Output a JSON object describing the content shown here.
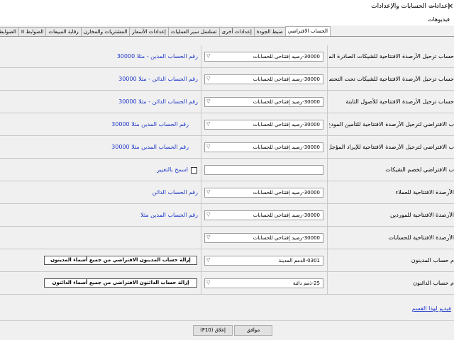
{
  "window": {
    "title": "إعدادات الحسابات والإعدادات",
    "minimize": "—",
    "close": "✕"
  },
  "menu": {
    "videos": "فيديوهات"
  },
  "tabs": [
    "الحساب الافتراضي",
    "ضبط الجودة",
    "إعدادات أخرى",
    "تسلسل سير العمليات",
    "إعدادات الأسعار",
    "المشتريات والمخازن",
    "رقابة المبيعات",
    "الضوابط II",
    "الضوابط I",
    "إع"
  ],
  "rows": [
    {
      "label": "حساب ترحيل الأرصدة الافتتاحية للشيكات الصادرة المؤجلة",
      "combo": "30000-رصيد إفتتاحي للحسابات",
      "hint": "رقم الحساب المدين - مثلا 30000"
    },
    {
      "label": "حساب ترحيل الأرصدة الافتتاحية للشيكات تحت التحصيل",
      "combo": "30000-رصيد إفتتاحي للحسابات",
      "hint": "رقم الحساب الدائن - مثلا 30000"
    },
    {
      "label": "حساب ترحيل الأرصدة الافتتاحية للأصول الثابتة",
      "combo": "30000-رصيد إفتتاحي للحسابات",
      "hint": "رقم الحساب الدائن - مثلا 30000"
    },
    {
      "label": "ب الافتراضي لترحيل الأرصدة الافتتاحية للتأمين المودع",
      "combo": "30000-رصيد إفتتاحي للحسابات",
      "hint": "رقم الحساب المدين مثلا 30000"
    },
    {
      "label": "ب الافتراضي لترحيل الأرصدة الافتتاحية للإيراد المؤجل",
      "combo": "30000-رصيد إفتتاحي للحسابات",
      "hint": "رقم الحساب المدين مثلا 30000"
    },
    {
      "label": "ب الافتراضي لخصم الشيكات",
      "combo": "",
      "checkbox_label": "اسمح بالتغيير"
    },
    {
      "label": "الأرصدة الافتتاحية للعملاء",
      "combo": "30000-رصيد إفتتاحي للحسابات",
      "hint": "رقم الحساب الدائن"
    },
    {
      "label": "الأرصدة الافتتاحية للموردين",
      "combo": "30000-رصيد إفتتاحي للحسابات",
      "hint": "رقم الحساب المدين مثلا"
    },
    {
      "label": "الأرصدة الافتتاحية للحسابات",
      "combo": "30000-رصيد إفتتاحي للحسابات"
    },
    {
      "label": "م حساب المدينون",
      "combo": "0301-الذمم المدينة",
      "button": "إزالة حساب المدينون الافتراضي من جميع أسماء المدينون"
    },
    {
      "label": "م حساب الدائنون",
      "combo": "25-ذمم دائنة",
      "button": "إزالة حساب الدائنون الافتراضي من جميع أسماء الدائنون"
    }
  ],
  "video_link": "فيديو لهذا القسم",
  "footer": {
    "close": "إغلاق (F10)",
    "ok": "موافق"
  },
  "icons": {
    "dropdown": "chevron-down-icon"
  }
}
